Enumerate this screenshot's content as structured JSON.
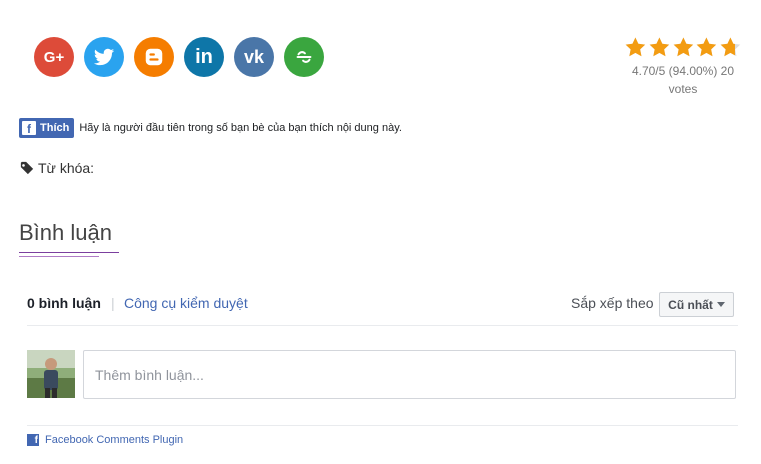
{
  "share": {
    "icons": [
      "google-plus-icon",
      "twitter-icon",
      "blogger-icon",
      "linkedin-icon",
      "vk-icon",
      "sharethis-icon"
    ],
    "colors": {
      "google_plus": "#dd4b39",
      "twitter": "#2aa3ef",
      "blogger": "#f57d00",
      "linkedin": "#0e76a8",
      "vk": "#4a76a8",
      "sharethis": "#3aa63f"
    },
    "gplus_text": "G+",
    "linkedin_text": "in",
    "vk_text": "vk"
  },
  "rating": {
    "stars_filled": 4.7,
    "stars_total": 5,
    "star_color": "#f39c12",
    "line1": "4.70/5 (94.00%) 20",
    "line2": "votes"
  },
  "facebook_like": {
    "button_label": "Thích",
    "text": "Hãy là người đầu tiên trong số bạn bè của bạn thích nội dung này."
  },
  "tags": {
    "label": "Từ khóa:"
  },
  "comments_section": {
    "title": "Bình luận",
    "count_label": "0 bình luận",
    "moderation_link": "Công cụ kiểm duyệt",
    "sort_label": "Sắp xếp theo",
    "sort_value": "Cũ nhất",
    "input_placeholder": "Thêm bình luận...",
    "plugin_label": "Facebook Comments Plugin"
  }
}
